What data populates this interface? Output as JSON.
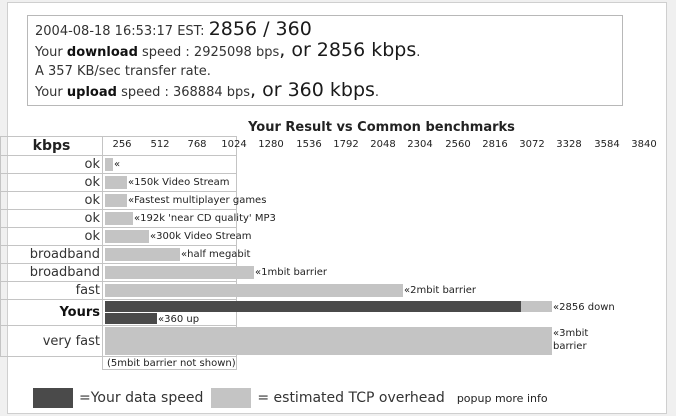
{
  "summary": {
    "timestamp": "2004-08-18 16:53:17 EST:",
    "headline": "2856 / 360",
    "dl_prefix": "Your",
    "dl_bold": "download",
    "dl_mid": "speed : 2925098 bps",
    "dl_big": ", or 2856 kbps",
    "dl_end": ".",
    "transfer": "A 357 KB/sec transfer rate.",
    "ul_prefix": "Your",
    "ul_bold": "upload",
    "ul_mid": "speed : 368884 bps",
    "ul_big": ", or 360 kbps",
    "ul_end": "."
  },
  "benchmark": {
    "title": "Your Result vs Common benchmarks",
    "unit_header": "kbps",
    "max_kbps": 3840,
    "ticks": [
      "256",
      "512",
      "768",
      "1024",
      "1280",
      "1536",
      "1792",
      "2048",
      "2304",
      "2560",
      "2816",
      "3072",
      "3328",
      "3584",
      "3840"
    ],
    "rows": [
      {
        "label": "ok",
        "bars": [
          {
            "kbps": 56,
            "style": "light",
            "text": "«"
          }
        ]
      },
      {
        "label": "ok",
        "bars": [
          {
            "kbps": 150,
            "style": "light",
            "text": "«150k Video Stream"
          }
        ]
      },
      {
        "label": "ok",
        "bars": [
          {
            "kbps": 150,
            "style": "light",
            "text": "«Fastest multiplayer games"
          }
        ]
      },
      {
        "label": "ok",
        "bars": [
          {
            "kbps": 192,
            "style": "light",
            "text": "«192k 'near CD quality' MP3"
          }
        ]
      },
      {
        "label": "ok",
        "bars": [
          {
            "kbps": 300,
            "style": "light",
            "text": "«300k Video Stream"
          }
        ]
      },
      {
        "label": "broadband",
        "bars": [
          {
            "kbps": 512,
            "style": "light",
            "text": "«half megabit"
          }
        ]
      },
      {
        "label": "broadband",
        "bars": [
          {
            "kbps": 1024,
            "style": "light",
            "text": "«1mbit barrier"
          }
        ]
      },
      {
        "label": "fast",
        "bars": [
          {
            "kbps": 2048,
            "style": "light",
            "text": "«2mbit barrier"
          }
        ]
      },
      {
        "label": "Yours",
        "bold": true,
        "two": true,
        "bars": [
          {
            "kbps": 2856,
            "style": "dark",
            "overhead_kbps": 3072,
            "text": "«2856 down"
          },
          {
            "kbps": 360,
            "style": "dark",
            "text": "«360 up"
          }
        ]
      },
      {
        "label": "very fast",
        "tall": true,
        "bars": [
          {
            "kbps": 3072,
            "style": "light",
            "text": "«3mbit barrier"
          }
        ]
      }
    ],
    "footnote": "(5mbit barrier not shown)"
  },
  "legend": {
    "dark_text": "=Your data speed",
    "light_text": "= estimated TCP overhead",
    "popup": "popup more info",
    "colors": {
      "dark": "#4a4a4a",
      "light": "#c4c4c4"
    }
  }
}
